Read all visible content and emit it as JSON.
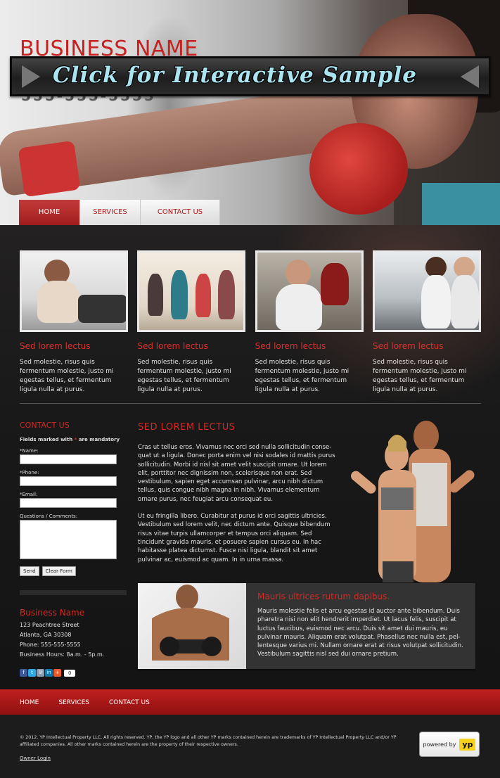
{
  "header": {
    "business_name": "BUSINESS NAME",
    "phone": "555-555-5555",
    "banner_text": "Click for Interactive Sample"
  },
  "nav": {
    "items": [
      {
        "label": "HOME",
        "active": true
      },
      {
        "label": "SERVICES",
        "active": false
      },
      {
        "label": "CONTACT US",
        "active": false
      }
    ]
  },
  "features": [
    {
      "title": "Sed lorem lectus",
      "body": "Sed molestie, risus quis fermentum molestie, justo mi egestas tellus, et fermentum ligula nulla at purus."
    },
    {
      "title": "Sed lorem lectus",
      "body": "Sed molestie, risus quis fermentum molestie, justo mi egestas tellus, et fermentum ligula nulla at purus."
    },
    {
      "title": "Sed lorem lectus",
      "body": "Sed molestie, risus quis fermentum molestie, justo mi egestas tellus, et fermentum ligula nulla at purus."
    },
    {
      "title": "Sed lorem lectus",
      "body": "Sed molestie, risus quis fermentum molestie, justo mi egestas tellus, et fermentum ligula nulla at purus."
    }
  ],
  "contact_form": {
    "title": "CONTACT US",
    "mandatory_prefix": "Fields marked with",
    "mandatory_star": "*",
    "mandatory_suffix": "are mandatory",
    "name_label": "*Name:",
    "phone_label": "*Phone:",
    "email_label": "*Email:",
    "comments_label": "Questions / Comments:",
    "send_label": "Send",
    "clear_label": "Clear Form"
  },
  "business_info": {
    "name": "Business Name",
    "street": "123 Peachtree Street",
    "city": "Atlanta, GA 30308",
    "phone": "Phone: 555-555-5555",
    "hours": "Business Hours: 8a.m. - 5p.m."
  },
  "social": {
    "icons": [
      "facebook-icon",
      "twitter-icon",
      "email-icon",
      "linkedin-icon",
      "plus-share-icon"
    ],
    "count": "0"
  },
  "article": {
    "title": "SED LOREM LECTUS",
    "p1": "Cras ut tellus eros. Vivamus nec orci sed nulla sollicitudin conse-quat ut a ligula. Donec porta enim vel nisi sodales id mattis purus sollicitudin. Morbi id nisl sit amet velit suscipit ornare. Ut lorem elit, porttitor nec dignissim non, scelerisque non erat. Sed vestibulum, sapien eget accumsan pulvinar, arcu nibh dictum tellus, quis congue nibh magna in nibh. Vivamus elementum ornare purus, nec feugiat arcu consequat eu.",
    "p2": "Ut eu fringilla libero. Curabitur at purus id orci sagittis ultricies. Vestibulum sed lorem velit, nec dictum ante. Quisque bibendum risus vitae turpis ullamcorper et tempus orci aliquam. Sed tincidunt gravida mauris, et posuere sapien cursus eu. In hac habitasse platea dictumst. Fusce nisi ligula, blandit sit amet pulvinar ac, euismod ac quam. In in urna massa."
  },
  "promo": {
    "title": "Mauris ultrices rutrum dapibus.",
    "body": "Mauris molestie felis et arcu egestas id auctor ante bibendum. Duis pharetra nisi non elit hendrerit imperdiet. Ut lacus felis, suscipit at luctus faucibus, euismod nec arcu. Duis sit amet dui mauris, eu pulvinar mauris. Aliquam erat volutpat. Phasellus nec nulla est, pel-lentesque varius mi. Nullam ornare erat at risus volutpat sollicitudin. Vestibulum sagittis nisl sed dui ornare pretium."
  },
  "footer": {
    "nav": [
      "HOME",
      "SERVICES",
      "CONTACT US"
    ],
    "copyright": "© 2012. YP Intellectual Property LLC. All rights reserved. YP, the YP logo and all other YP marks contained herein are trademarks of YP Intellectual Property LLC and/or YP affiliated companies. All other marks contained herein are the property of their respective owners.",
    "owner_login": "Owner Login",
    "powered_by": "powered by",
    "yp_logo": "yp"
  },
  "colors": {
    "accent_red": "#d52a24",
    "nav_active": "#b3201f",
    "footer_bar": "#a51716",
    "banner_text": "#a9e4f0"
  }
}
